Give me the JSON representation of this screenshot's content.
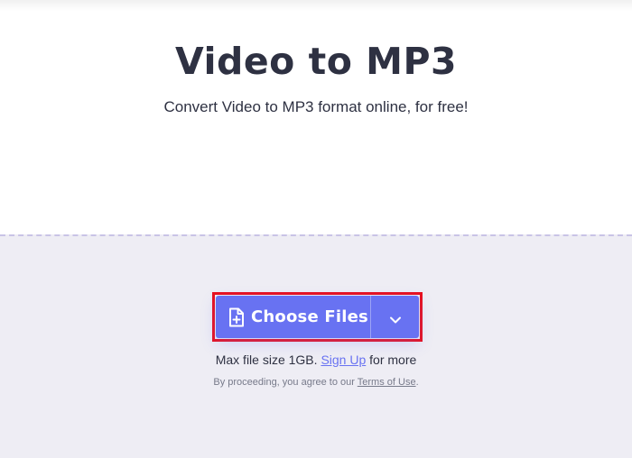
{
  "hero": {
    "title": "Video to MP3",
    "subtitle": "Convert Video to MP3 format online, for free!"
  },
  "upload": {
    "choose_files_label": "Choose Files",
    "choose_files_icon": "file-plus-icon",
    "dropdown_icon": "chevron-down-icon",
    "size_note_prefix": "Max file size 1GB.",
    "sign_up_label": "Sign Up",
    "size_note_suffix": "for more",
    "terms_prefix": "By proceeding, you agree to our",
    "terms_link_label": "Terms of Use",
    "terms_suffix": "."
  },
  "colors": {
    "accent": "#6872f2",
    "highlight": "#e8101e",
    "drop_zone_bg": "#eeedf4",
    "text_dark": "#2e3142"
  }
}
